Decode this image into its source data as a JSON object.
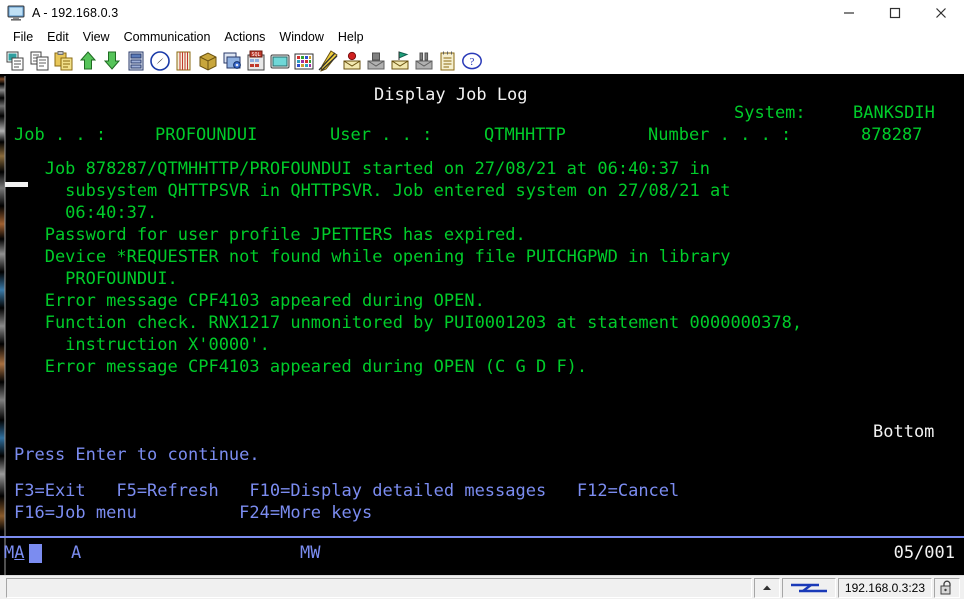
{
  "window": {
    "title": "A - 192.168.0.3",
    "icon": "monitor-icon",
    "minimize_label": "Minimize",
    "maximize_label": "Maximize",
    "close_label": "Close"
  },
  "menubar": {
    "items": [
      {
        "label": "File"
      },
      {
        "label": "Edit"
      },
      {
        "label": "View"
      },
      {
        "label": "Communication"
      },
      {
        "label": "Actions"
      },
      {
        "label": "Window"
      },
      {
        "label": "Help"
      }
    ]
  },
  "toolbar": {
    "buttons": [
      {
        "name": "cut-icon"
      },
      {
        "name": "copy-icon"
      },
      {
        "name": "paste-icon"
      },
      {
        "name": "send-file-icon"
      },
      {
        "name": "receive-file-icon"
      },
      {
        "name": "display-icon"
      },
      {
        "name": "navigate-icon"
      },
      {
        "name": "spool-icon"
      },
      {
        "name": "package-icon"
      },
      {
        "name": "database-icon"
      },
      {
        "name": "sql-icon"
      },
      {
        "name": "keypad-icon"
      },
      {
        "name": "color-map-icon"
      },
      {
        "name": "macro-edit-icon"
      },
      {
        "name": "record-macro-icon"
      },
      {
        "name": "stop-macro-icon"
      },
      {
        "name": "play-macro-icon"
      },
      {
        "name": "pause-macro-icon"
      },
      {
        "name": "notepad-icon"
      },
      {
        "name": "help-icon"
      }
    ]
  },
  "terminal": {
    "header": {
      "title": "Display Job Log",
      "system_label": "System:",
      "system_value": "BANKSDIH",
      "job_label": "Job . . :",
      "job_value": "PROFOUNDUI",
      "user_label": "User . . :",
      "user_value": "QTMHHTTP",
      "number_label": "Number . . . :",
      "number_value": "878287"
    },
    "messages": [
      "   Job 878287/QTMHHTTP/PROFOUNDUI started on 27/08/21 at 06:40:37 in",
      "     subsystem QHTTPSVR in QHTTPSVR. Job entered system on 27/08/21 at",
      "     06:40:37.",
      "   Password for user profile JPETTERS has expired.",
      "   Device *REQUESTER not found while opening file PUICHGPWD in library",
      "     PROFOUNDUI.",
      "   Error message CPF4103 appeared during OPEN.",
      "   Function check. RNX1217 unmonitored by PUI0001203 at statement 0000000378,",
      "     instruction X'0000'.",
      "   Error message CPF4103 appeared during OPEN (C G D F)."
    ],
    "bottom_indicator": "Bottom",
    "prompt": "Press Enter to continue.",
    "function_keys_line1": "F3=Exit   F5=Refresh   F10=Display detailed messages   F12=Cancel",
    "function_keys_line2": "F16=Job menu          F24=More keys",
    "oia": {
      "mode": "MA",
      "attention": "A",
      "message_wait": "MW",
      "cursor_position": "05/001"
    }
  },
  "statusbar": {
    "main_text": "",
    "scroll_icon": "scroll-up-icon",
    "connection_icon": "connection-icon",
    "address": "192.168.0.3:23",
    "lock_icon": "keyboard-lock-icon"
  },
  "colors": {
    "terminal_green": "#00cc2a",
    "terminal_white": "#f2f2f2",
    "terminal_blue": "#7b8cf0",
    "terminal_bg": "#000000"
  }
}
